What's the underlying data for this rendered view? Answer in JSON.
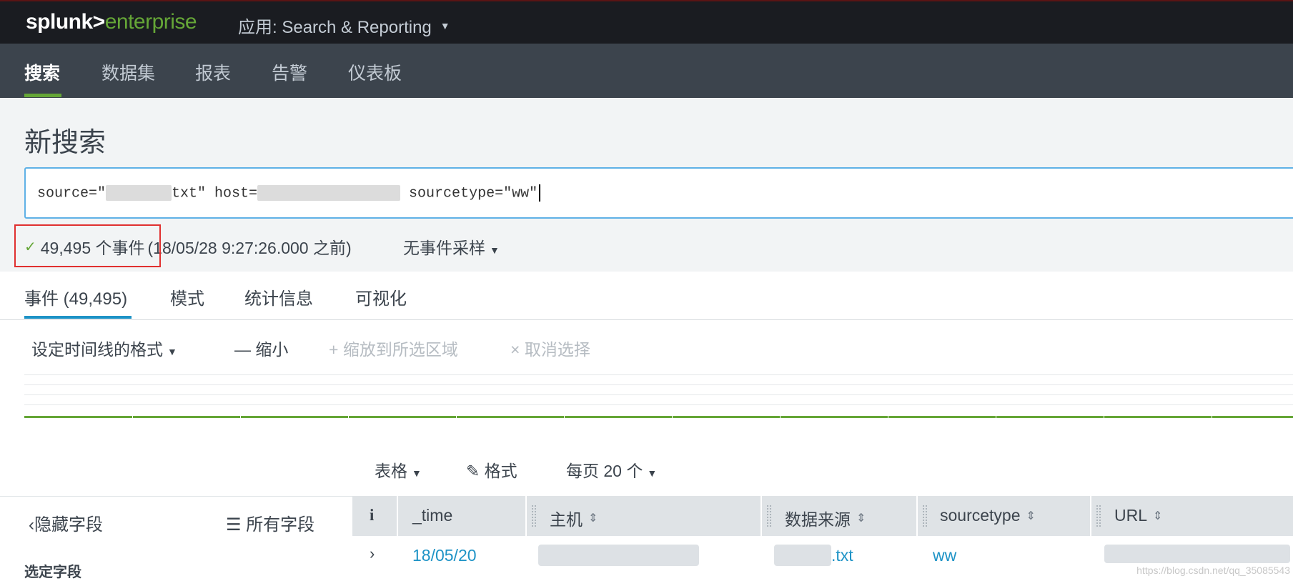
{
  "app": {
    "logo_primary": "splunk>",
    "logo_secondary": "enterprise",
    "app_menu_label": "应用: Search & Reporting"
  },
  "nav": {
    "items": [
      "搜索",
      "数据集",
      "报表",
      "告警",
      "仪表板"
    ]
  },
  "search": {
    "title": "新搜索",
    "query_part1": "source=\"",
    "query_part2": "txt\" host=",
    "query_part3": " sourcetype=\"ww\"",
    "event_count": "49,495 个事件",
    "timestamp": "(18/05/28 9:27:26.000 之前)",
    "sampling": "无事件采样"
  },
  "tabs": [
    "事件 (49,495)",
    "模式",
    "统计信息",
    "可视化"
  ],
  "timeline": {
    "format": "设定时间线的格式",
    "zoom_out": "— 缩小",
    "zoom_to_selection": "+ 缩放到所选区域",
    "deselect": "× 取消选择"
  },
  "results_toolbar": {
    "view": "表格",
    "format": "格式",
    "per_page": "每页 20 个"
  },
  "sidebar": {
    "hide_fields": "隐藏字段",
    "all_fields": "所有字段",
    "selected_fields": "选定字段"
  },
  "table": {
    "info_col": "i",
    "columns": [
      "_time",
      "主机",
      "数据来源",
      "sourcetype",
      "URL"
    ],
    "row": {
      "time": "18/05/20",
      "source_suffix": ".txt",
      "sourcetype": "ww"
    }
  },
  "watermark": "https://blog.csdn.net/qq_35085543",
  "colors": {
    "accent_green": "#65a637",
    "accent_blue": "#1e93c6",
    "appbar": "#1a1c21",
    "navbar": "#3c444d",
    "highlight_red": "#e0302f"
  }
}
